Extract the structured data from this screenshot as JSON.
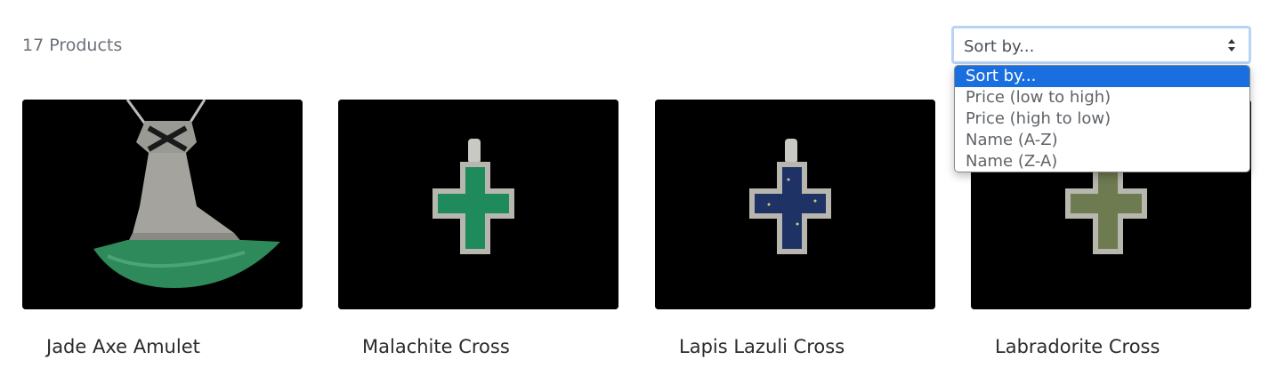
{
  "listing": {
    "product_count": "17 Products"
  },
  "sort": {
    "current_value": "Sort by...",
    "options": [
      "Sort by...",
      "Price (low to high)",
      "Price (high to low)",
      "Name (A-Z)",
      "Name (Z-A)"
    ],
    "selected_index": 0,
    "highlight_color": "#1a6fe0"
  },
  "products": [
    {
      "name": "Jade Axe Amulet",
      "stone_color": "#2e8a5a"
    },
    {
      "name": "Malachite Cross",
      "stone_color": "#1f8a5c"
    },
    {
      "name": "Lapis Lazuli Cross",
      "stone_color": "#1f3266"
    },
    {
      "name": "Labradorite Cross",
      "stone_color": "#6e7a50"
    }
  ]
}
